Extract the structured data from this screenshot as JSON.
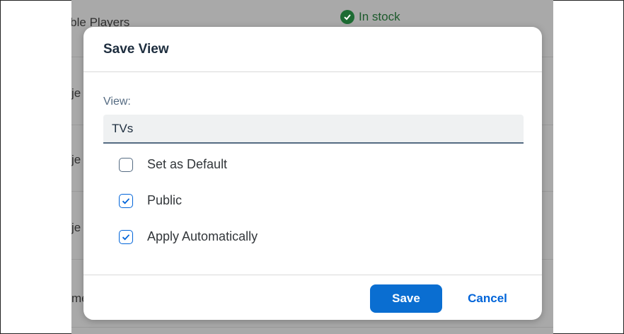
{
  "background": {
    "row1_text": "table Players",
    "row_fragments": [
      "je",
      "je",
      "je",
      "me"
    ],
    "stock_status": "In stock",
    "stock_color": "#1d6b33"
  },
  "dialog": {
    "title": "Save View",
    "view_label": "View:",
    "view_value": "TVs",
    "checkboxes": [
      {
        "label": "Set as Default",
        "checked": false
      },
      {
        "label": "Public",
        "checked": true
      },
      {
        "label": "Apply Automatically",
        "checked": true
      }
    ],
    "save_label": "Save",
    "cancel_label": "Cancel"
  },
  "colors": {
    "primary": "#0a6ed1",
    "link": "#0064d9"
  }
}
